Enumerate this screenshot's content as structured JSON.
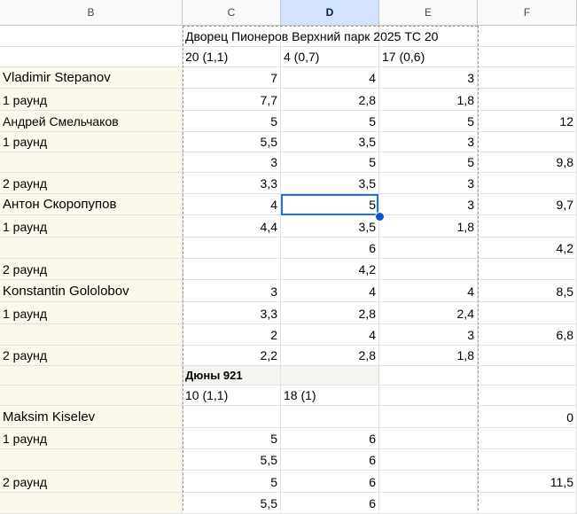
{
  "columns": [
    "B",
    "C",
    "D",
    "E",
    "F"
  ],
  "selected_column": "D",
  "rows": [
    {
      "b": "",
      "c": "Дворец Пионеров Верхний парк 2025 ТС 20",
      "d": "",
      "e": "",
      "f": ""
    },
    {
      "b": "",
      "c": "20 (1,1)",
      "d": "4 (0,7)",
      "e": "17 (0,6)",
      "f": ""
    },
    {
      "b": "Vladimir Stepanov",
      "c": "7",
      "d": "4",
      "e": "3",
      "f": ""
    },
    {
      "b": "1 раунд",
      "c": "7,7",
      "d": "2,8",
      "e": "1,8",
      "f": ""
    },
    {
      "b": "Андрей Смельчаков",
      "c": "5",
      "d": "5",
      "e": "5",
      "f": "12"
    },
    {
      "b": "1 раунд",
      "c": "5,5",
      "d": "3,5",
      "e": "3",
      "f": ""
    },
    {
      "b": "",
      "c": "3",
      "d": "5",
      "e": "5",
      "f": "9,8"
    },
    {
      "b": "2 раунд",
      "c": "3,3",
      "d": "3,5",
      "e": "3",
      "f": ""
    },
    {
      "b": "Антон Скоропупов",
      "c": "4",
      "d": "5",
      "e": "3",
      "f": "9,7"
    },
    {
      "b": "1 раунд",
      "c": "4,4",
      "d": "3,5",
      "e": "1,8",
      "f": ""
    },
    {
      "b": "",
      "c": "",
      "d": "6",
      "e": "",
      "f": "4,2"
    },
    {
      "b": "2 раунд",
      "c": "",
      "d": "4,2",
      "e": "",
      "f": ""
    },
    {
      "b": "Konstantin Gololobov",
      "c": "3",
      "d": "4",
      "e": "4",
      "f": "8,5"
    },
    {
      "b": "1 раунд",
      "c": "3,3",
      "d": "2,8",
      "e": "2,4",
      "f": ""
    },
    {
      "b": "",
      "c": "2",
      "d": "4",
      "e": "3",
      "f": "6,8"
    },
    {
      "b": "2 раунд",
      "c": "2,2",
      "d": "2,8",
      "e": "1,8",
      "f": ""
    },
    {
      "b": "",
      "c": "Дюны 921",
      "d": "",
      "e": "",
      "f": ""
    },
    {
      "b": "",
      "c": "10 (1,1)",
      "d": "18 (1)",
      "e": "",
      "f": ""
    },
    {
      "b": "Maksim Kiselev",
      "c": "",
      "d": "",
      "e": "",
      "f": "0"
    },
    {
      "b": "1 раунд",
      "c": "5",
      "d": "6",
      "e": "",
      "f": ""
    },
    {
      "b": "",
      "c": "5,5",
      "d": "6",
      "e": "",
      "f": ""
    },
    {
      "b": "2 раунд",
      "c": "5",
      "d": "6",
      "e": "",
      "f": "11,5"
    },
    {
      "b": "",
      "c": "5,5",
      "d": "6",
      "e": "",
      "f": ""
    }
  ],
  "active_cell": "D9"
}
